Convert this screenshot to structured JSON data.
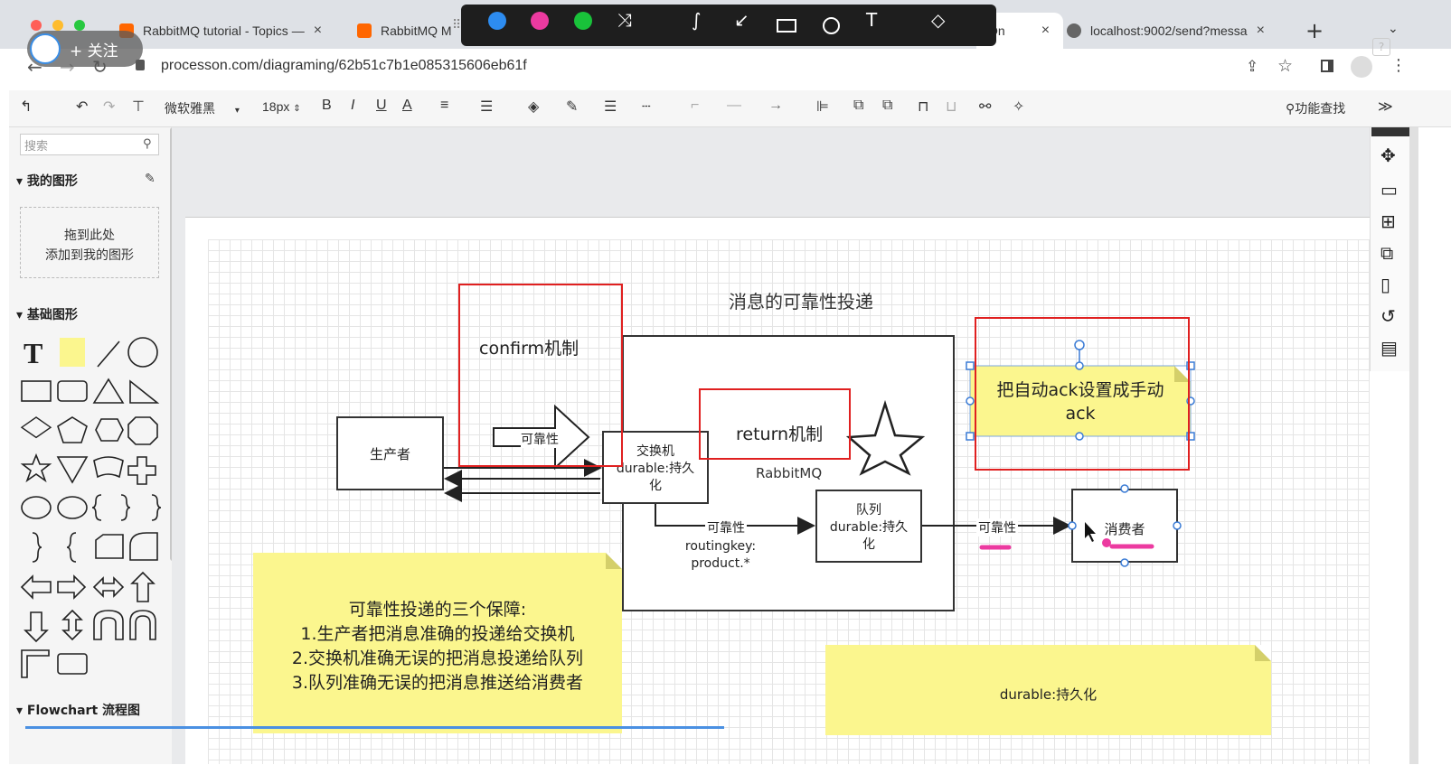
{
  "browser": {
    "tabs": [
      {
        "title": "RabbitMQ tutorial - Topics —",
        "close": "×"
      },
      {
        "title": "RabbitMQ M",
        "close": ""
      },
      {
        "title": "sOn",
        "close": "×"
      },
      {
        "title": "localhost:9002/send?messa",
        "close": "×"
      }
    ],
    "new_tab": "+",
    "url": "processon.com/diagraming/62b51c7b1e085315606eb61f",
    "follow_label": "+ 关注"
  },
  "toolbar": {
    "font_name": "微软雅黑",
    "font_size": "18px",
    "bold": "B",
    "italic": "I",
    "underline": "U",
    "font_color": "A",
    "feature_search": "功能查找"
  },
  "sidebar": {
    "search_placeholder": "搜索",
    "my_shapes": "我的图形",
    "drop_line1": "拖到此处",
    "drop_line2": "添加到我的图形",
    "basic_shapes": "基础图形",
    "text_tool": "T",
    "flowchart": "Flowchart 流程图"
  },
  "diagram": {
    "title": "消息的可靠性投递",
    "confirm": "confirm机制",
    "return": "return机制",
    "producer": "生产者",
    "arrow_reliability": "可靠性",
    "exchange_l1": "交换机",
    "exchange_l2": "durable:持久",
    "exchange_l3": "化",
    "rabbitmq": "RabbitMQ",
    "queue_l1": "队列",
    "queue_l2": "durable:持久",
    "queue_l3": "化",
    "edge_reliability": "可靠性",
    "routingkey_l1": "routingkey:",
    "routingkey_l2": "product.*",
    "edge_reliability2": "可靠性",
    "consumer": "消费者",
    "ack_l1": "把自动ack设置成手动",
    "ack_l2": "ack",
    "note_title": "可靠性投递的三个保障:",
    "note_l1": "1.生产者把消息准确的投递给交换机",
    "note_l2": "2.交换机准确无误的把消息投递给队列",
    "note_l3": "3.队列准确无误的把消息推送给消费者",
    "note2": "durable:持久化"
  },
  "colors": {
    "highlight_red": "#e02020",
    "sticky_yellow": "#fbf68e",
    "pen_pink": "#ec3aa0"
  }
}
